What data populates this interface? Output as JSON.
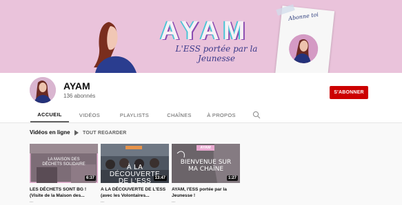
{
  "banner": {
    "title": "AYAM",
    "subtitle": "L'ESS portée par la Jeunesse",
    "card_script": "Abonne toi"
  },
  "channel": {
    "name": "AYAM",
    "subscribers": "136 abonnés",
    "subscribe_label": "S'ABONNER",
    "subscribe_color": "#cc0000"
  },
  "tabs": [
    {
      "label": "ACCUEIL",
      "active": true
    },
    {
      "label": "VIDÉOS"
    },
    {
      "label": "PLAYLISTS"
    },
    {
      "label": "CHAÎNES"
    },
    {
      "label": "À PROPOS"
    }
  ],
  "search_icon": "search-icon",
  "section": {
    "title": "Vidéos en ligne",
    "play_all_label": "TOUT REGARDER"
  },
  "videos": [
    {
      "thumb_text": "LA MAISON DES DÉCHETS SOLIDAIRE",
      "duration": "6:37",
      "title": "LES DÉCHETS SONT BG ! (Visite de la Maison des...",
      "meta": "..."
    },
    {
      "thumb_text": "À LA DÉCOUVERTE DE L'ESS",
      "duration": "13:47",
      "title": "A LA DÉCOUVERTE DE L'ESS (avec les Volontaires...",
      "meta": "..."
    },
    {
      "thumb_tag": "AYAM",
      "thumb_text": "BIENVENUE SUR MA CHAÎNE",
      "duration": "1:27",
      "title": "AYAM, l'ESS portée par la Jeunesse !",
      "meta": "..."
    }
  ]
}
